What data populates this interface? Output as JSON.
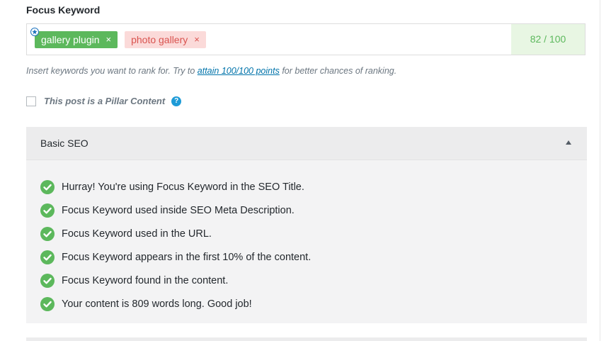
{
  "focus_keyword": {
    "title": "Focus Keyword",
    "keywords": [
      {
        "label": "gallery plugin",
        "remove": "×",
        "primary": true
      },
      {
        "label": "photo gallery",
        "remove": "×",
        "primary": false
      }
    ],
    "score": "82 / 100",
    "hint_before": "Insert keywords you want to rank for. Try to ",
    "hint_link": "attain 100/100 points",
    "hint_after": " for better chances of ranking."
  },
  "pillar": {
    "label": "This post is a Pillar Content",
    "help": "?"
  },
  "basic_seo": {
    "title": "Basic SEO",
    "checks": [
      "Hurray! You're using Focus Keyword in the SEO Title.",
      "Focus Keyword used inside SEO Meta Description.",
      "Focus Keyword used in the URL.",
      "Focus Keyword appears in the first 10% of the content.",
      "Focus Keyword found in the content.",
      "Your content is 809 words long. Good job!"
    ]
  },
  "colors": {
    "success": "#5cb85c",
    "success_bg": "#e8f6e3",
    "error_text": "#d9534f",
    "error_bg": "#fbdad9",
    "link": "#0073aa",
    "help": "#1e9bd7"
  },
  "icons": {
    "primary_keyword": "star-badge-icon",
    "check": "check-circle-icon",
    "collapse": "caret-up-icon",
    "help": "help-circle-icon"
  }
}
